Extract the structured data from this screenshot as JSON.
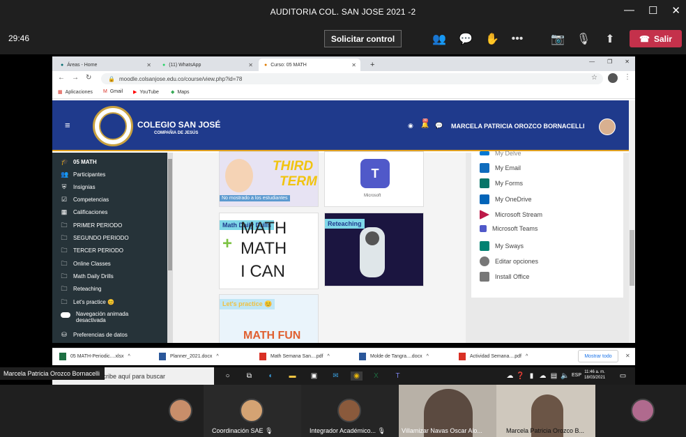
{
  "window": {
    "title": "AUDITORIA COL. SAN JOSE 2021 -2"
  },
  "meeting": {
    "timer": "29:46",
    "request_control": "Solicitar control",
    "leave": "Salir",
    "presenter_name": "Marcela Patricia Orozco Bornacelli"
  },
  "browser": {
    "tabs": [
      {
        "label": "Áreas - Home"
      },
      {
        "label": "(11) WhatsApp"
      },
      {
        "label": "Curso: 05 MATH"
      }
    ],
    "url": "moodle.colsanjose.edu.co/course/view.php?id=78",
    "bookmarks": [
      "Aplicaciones",
      "Gmail",
      "YouTube",
      "Maps"
    ]
  },
  "site": {
    "school_name": "COLEGIO SAN JOSÉ",
    "school_sub": "COMPAÑIA DE JESÚS",
    "user_name": "MARCELA PATRICIA OROZCO BORNACELLI",
    "notification_count": "30"
  },
  "sidebar": {
    "course": "05 MATH",
    "items": [
      "Participantes",
      "Insignias",
      "Competencias",
      "Calificaciones",
      "PRIMER PERIODO",
      "SEGUNDO PERIODO",
      "TERCER PERIODO",
      "Online Classes",
      "Math Daily Drills",
      "Reteaching",
      "Let's practice 😊"
    ],
    "nav_anim_1": "Navegación animada",
    "nav_anim_2": "desactivada",
    "prefs": "Preferencias de datos"
  },
  "cards": {
    "third_term_title_1": "THIRD",
    "third_term_title_2": "TERM",
    "hidden_note": "No mostrado a los estudiantes",
    "math_daily_drills": "Math Daily Drills",
    "reteaching": "Reteaching",
    "lets_practice": "Let's practice 😊",
    "teams_brand": "Microsoft",
    "math_line_1": "MATH",
    "math_line_2": "MATH",
    "math_line_3": "I CAN",
    "math_fun": "MATH FUN"
  },
  "office_block": {
    "items": [
      {
        "label": "My Email",
        "color": "#0f6cbd"
      },
      {
        "label": "My Forms",
        "color": "#077568"
      },
      {
        "label": "My OneDrive",
        "color": "#0364b8"
      },
      {
        "label": "Microsoft Stream",
        "color": "#bc1948"
      },
      {
        "label": "Microsoft Teams",
        "color": "#5059c9"
      },
      {
        "label": "My Sways",
        "color": "#008272"
      },
      {
        "label": "Editar opciones",
        "color": "#777777"
      },
      {
        "label": "Install Office",
        "color": "#777777"
      }
    ],
    "partial_top": "My Delve"
  },
  "downloads": {
    "items": [
      "05 MATH-Periodic....xlsx",
      "Planner_2021.docx",
      "Math Semana San....pdf",
      "Molde de Tangra....docx",
      "Actividad Semana....pdf"
    ],
    "show_all": "Mostrar todo"
  },
  "taskbar": {
    "search_placeholder": "Escribe aquí para buscar",
    "lang": "ESP",
    "time": "11:46 a. m.",
    "date": "18/03/2021"
  },
  "gallery": {
    "participants": [
      "Coordinación SAE",
      "Integrador Académico...",
      "Villamizar Navas Oscar Alo...",
      "Marcela Patricia Orozco B..."
    ]
  }
}
